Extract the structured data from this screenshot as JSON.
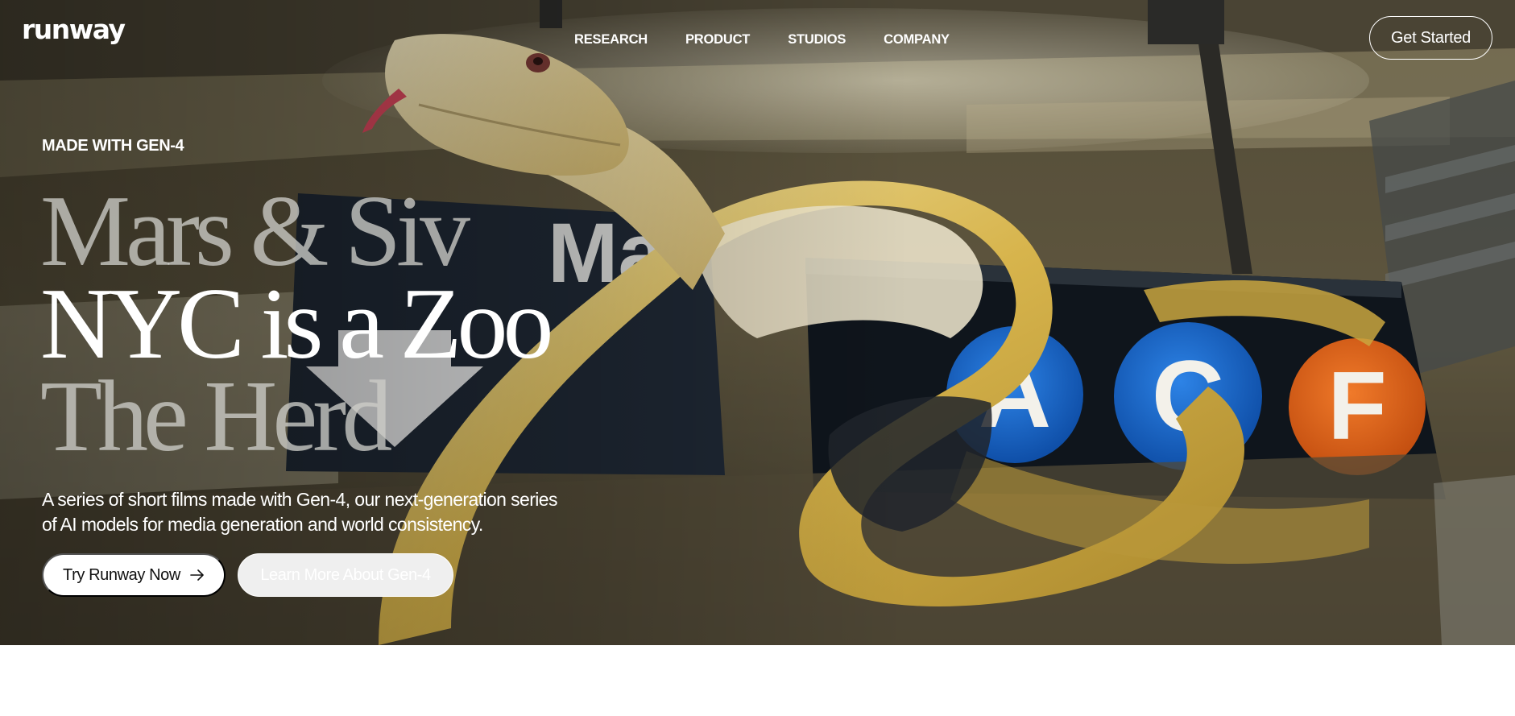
{
  "header": {
    "logo": "runway",
    "nav": {
      "research": "RESEARCH",
      "product": "PRODUCT",
      "studios": "STUDIOS",
      "company": "COMPANY"
    },
    "get_started": "Get Started"
  },
  "hero": {
    "eyebrow": "MADE WITH GEN-4",
    "titles": [
      "Mars & Siv",
      "NYC is a Zoo",
      "The Herd"
    ],
    "description_line_1": "A series of short films made with Gen-4, our next-generation series",
    "description_line_2": "of AI models for media generation and world consistency.",
    "cta_primary": "Try Runway Now",
    "cta_secondary": "Learn More About Gen-4",
    "background_image_subject": "albino python coiled on NYC subway sign",
    "subway_sign": {
      "partial_text": "Ma",
      "lines": [
        {
          "letter": "A",
          "color": "#1560bd"
        },
        {
          "letter": "C",
          "color": "#1560bd"
        },
        {
          "letter": "F",
          "color": "#e0621b"
        }
      ]
    }
  },
  "icons": {
    "cta_arrow": "arrow-right-icon",
    "sign_arrow": "arrow-down-icon"
  }
}
